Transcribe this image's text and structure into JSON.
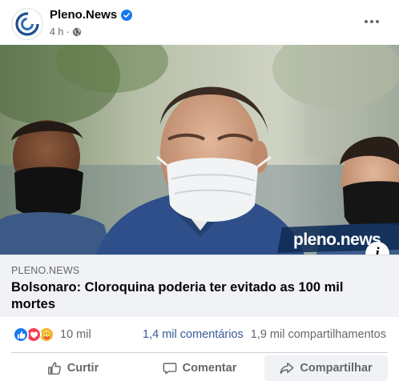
{
  "post": {
    "page_name": "Pleno.News",
    "time": "4 h",
    "separator": "·",
    "audience_icon": "globe-icon",
    "more_icon": "more-options-icon"
  },
  "image": {
    "watermark": "pleno.news",
    "info_label": "i"
  },
  "link_preview": {
    "domain": "PLENO.NEWS",
    "title": "Bolsonaro: Cloroquina poderia ter evitado as 100 mil mortes"
  },
  "stats": {
    "reactions": [
      "like",
      "love",
      "care"
    ],
    "reaction_count": "10 mil",
    "comments": "1,4 mil comentários",
    "shares": "1,9 mil compartilhamentos"
  },
  "actions": {
    "like": "Curtir",
    "comment": "Comentar",
    "share": "Compartilhar"
  },
  "colors": {
    "verified": "#1877f2",
    "like": "#1877f2",
    "love": "#f33e58",
    "care": "#f7b125",
    "link_bg": "#f0f2f5"
  }
}
